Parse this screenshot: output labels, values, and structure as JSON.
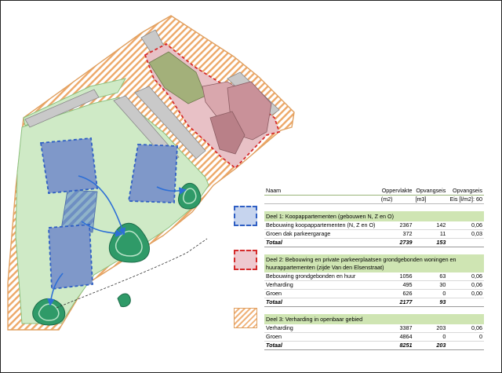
{
  "colors": {
    "hatch_orange": "#e6954a",
    "green_area": "#cfeac6",
    "blue_building": "#7f98c9",
    "blue_dash": "#2f5fc4",
    "red_dash": "#d52b2b",
    "pink_building": "#d9a7ad",
    "olive_roof": "#a3b07a",
    "pond_green": "#2f9a68",
    "table_section": "#cfe5b3"
  },
  "table": {
    "headers": {
      "name": "Naam",
      "area": "Oppervlakte",
      "volume": "Opvangseis",
      "req": "Opvangseis"
    },
    "units": {
      "area": "(m2)",
      "volume": "[m3]",
      "req_label": "Eis [l/m2]:",
      "req_value": "60"
    },
    "sections": [
      {
        "title": "Deel 1: Koopappartementen (gebouwen N, Z en O)",
        "rows": [
          {
            "name": "Bebouwing koopappartementen (N, Z en O)",
            "area": "2367",
            "volume": "142",
            "req": "0,06"
          },
          {
            "name": "Groen dak parkeergarage",
            "area": "372",
            "volume": "11",
            "req": "0,03"
          }
        ],
        "total": {
          "name": "Totaal",
          "area": "2739",
          "volume": "153",
          "req": ""
        }
      },
      {
        "title": "Deel 2: Bebouwing en private parkeerplaatsen grondgebonden woningen en",
        "title2": "huurappartementen (zijde Van den Elsenstraat)",
        "rows": [
          {
            "name": "Bebouwing grondgebonden en huur",
            "area": "1056",
            "volume": "63",
            "req": "0,06"
          },
          {
            "name": "Verharding",
            "area": "495",
            "volume": "30",
            "req": "0,06"
          },
          {
            "name": "Groen",
            "area": "626",
            "volume": "0",
            "req": "0,00"
          }
        ],
        "total": {
          "name": "Totaal",
          "area": "2177",
          "volume": "93",
          "req": ""
        }
      },
      {
        "title": "Deel 3: Verharding in openbaar gebied",
        "rows": [
          {
            "name": "Verharding",
            "area": "3387",
            "volume": "203",
            "req": "0,06"
          },
          {
            "name": "Groen",
            "area": "4864",
            "volume": "0",
            "req": "0"
          }
        ],
        "total": {
          "name": "Totaal",
          "area": "8251",
          "volume": "203",
          "req": ""
        }
      }
    ]
  }
}
